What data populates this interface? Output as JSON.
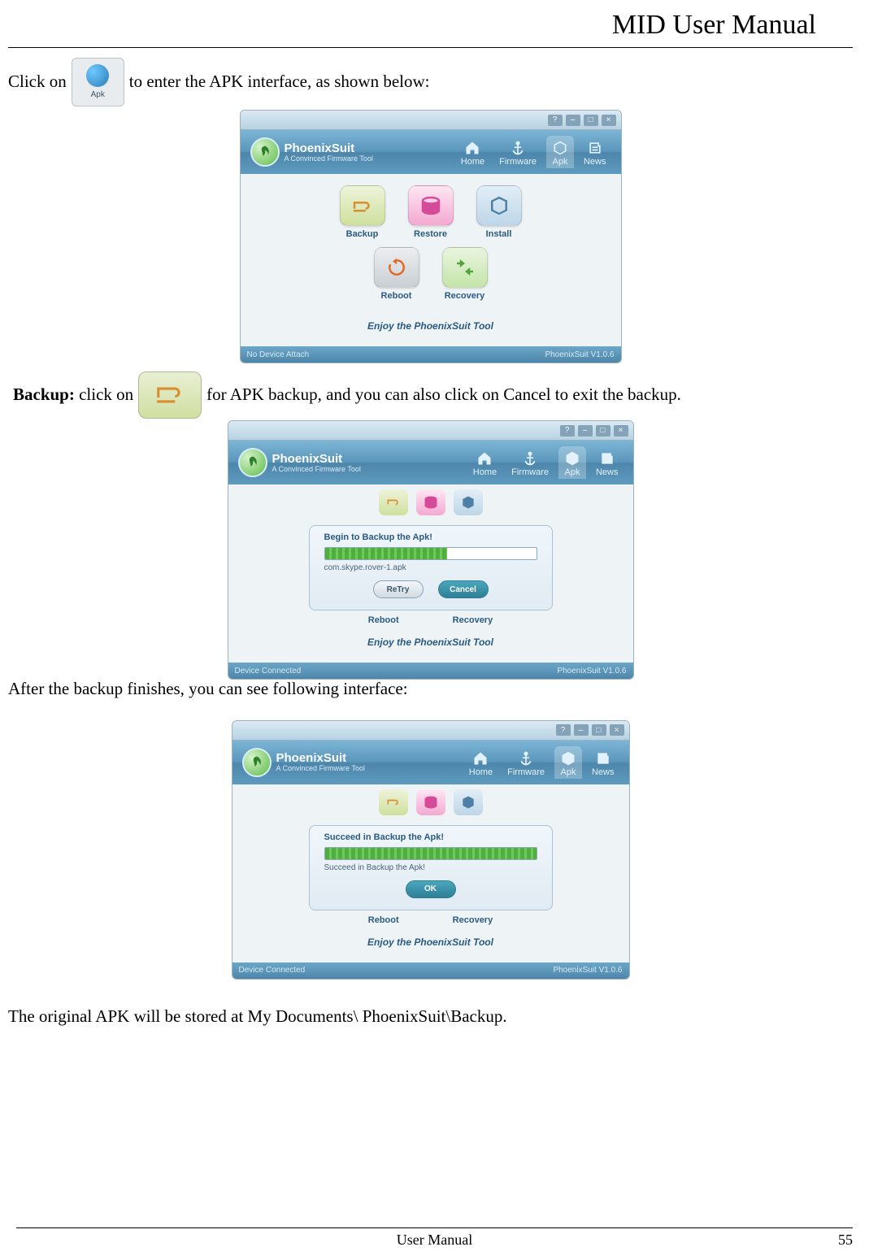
{
  "header": {
    "title": "MID User Manual"
  },
  "para": {
    "click_on": "Click on",
    "to_enter": "to enter the APK interface, as shown below:",
    "backup_bold": "Backup:",
    "backup_rest_a": " click on",
    "backup_rest_b": "for APK backup, and you can also click on Cancel to exit the backup.",
    "after_backup": "After the backup finishes, you can see following interface:",
    "stored_at": "The original APK will be stored at My Documents\\ PhoenixSuit\\Backup."
  },
  "apk_thumb_label": "Apk",
  "psuit": {
    "brand": "PhoenixSuit",
    "tagline": "A Convinced Firmware Tool",
    "tabs": {
      "home": "Home",
      "firmware": "Firmware",
      "apk": "Apk",
      "news": "News"
    },
    "buttons": {
      "backup": "Backup",
      "restore": "Restore",
      "install": "Install",
      "reboot": "Reboot",
      "recovery": "Recovery"
    },
    "footer": "Enjoy the PhoenixSuit Tool",
    "status_version": "PhoenixSuit V1.0.6",
    "status_left_1": "No Device Attach",
    "status_left_2": "Device Connected",
    "winbtns": {
      "help": "?",
      "min": "–",
      "max": "□",
      "close": "×"
    }
  },
  "dlg1": {
    "title": "Begin to Backup the Apk!",
    "file": "com.skype.rover-1.apk",
    "retry": "ReTry",
    "cancel": "Cancel"
  },
  "dlg2": {
    "title": "Succeed in Backup the Apk!",
    "sub": "Succeed in Backup the Apk!",
    "ok": "OK"
  },
  "footer": {
    "center": "User Manual",
    "page": "55"
  }
}
